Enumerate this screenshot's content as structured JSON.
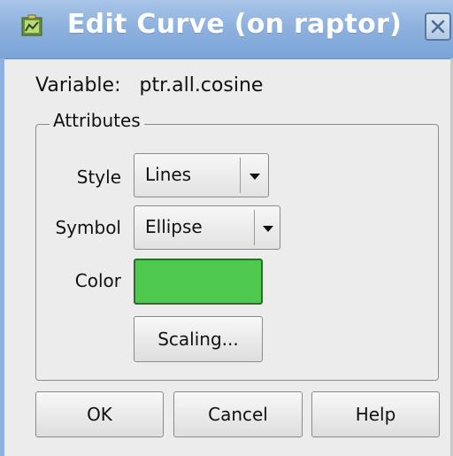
{
  "window": {
    "title": "Edit Curve (on raptor)"
  },
  "variable": {
    "label": "Variable:",
    "value": "ptr.all.cosine"
  },
  "attributes": {
    "group_title": "Attributes",
    "style": {
      "label": "Style",
      "selected": "Lines"
    },
    "symbol": {
      "label": "Symbol",
      "selected": "Ellipse"
    },
    "color": {
      "label": "Color",
      "value": "#4ec94e"
    },
    "scaling_label": "Scaling..."
  },
  "buttons": {
    "ok": "OK",
    "cancel": "Cancel",
    "help": "Help"
  },
  "icons": {
    "app": "app-icon",
    "close": "close-icon",
    "dropdown": "chevron-down-icon"
  }
}
